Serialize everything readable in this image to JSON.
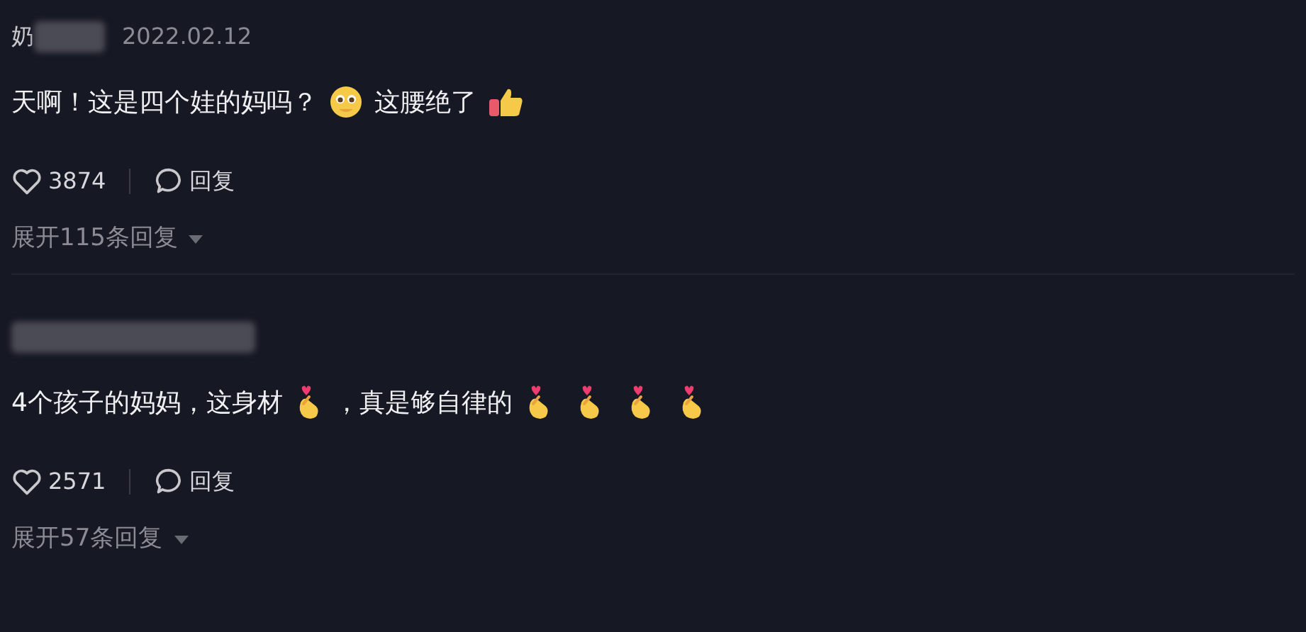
{
  "comments": [
    {
      "author": "奶",
      "date": "2022.02.12",
      "segments": [
        {
          "kind": "text",
          "text": "天啊！这是四个娃的妈吗？"
        },
        {
          "kind": "pleading-face"
        },
        {
          "kind": "text",
          "text": "这腰绝了"
        },
        {
          "kind": "thumbs-up"
        }
      ],
      "likes": "3874",
      "reply": "回复",
      "expand": "展开115条回复"
    },
    {
      "segments": [
        {
          "kind": "text",
          "text": "4个孩子的妈妈，这身材"
        },
        {
          "kind": "finger-heart"
        },
        {
          "kind": "text",
          "text": "，真是够自律的"
        },
        {
          "kind": "finger-heart"
        },
        {
          "kind": "finger-heart"
        },
        {
          "kind": "finger-heart"
        },
        {
          "kind": "finger-heart"
        }
      ],
      "likes": "2571",
      "reply": "回复",
      "expand": "展开57条回复"
    }
  ]
}
